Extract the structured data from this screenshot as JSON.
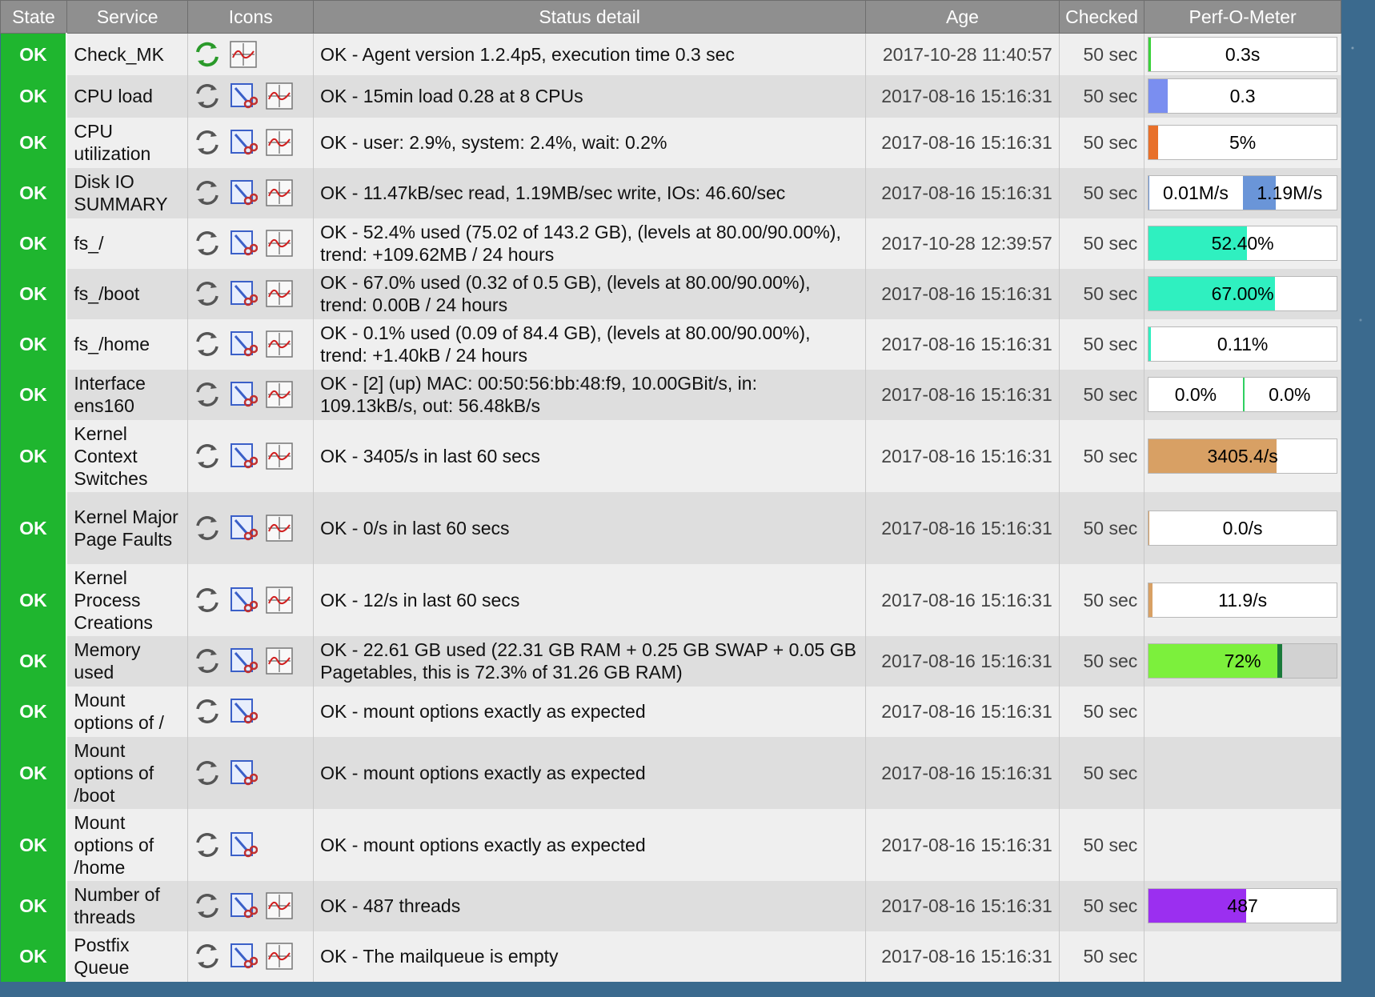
{
  "columns": {
    "state": "State",
    "service": "Service",
    "icons": "Icons",
    "status": "Status detail",
    "age": "Age",
    "checked": "Checked",
    "perf": "Perf-O-Meter"
  },
  "colors": {
    "ok": "#1fb62f",
    "header": "#8f8f8f",
    "load": "#7a8ef0",
    "fs": "#2ff0c0",
    "kernel": "#d8a064",
    "memory": "#7cf03c",
    "threads": "#9b2ff0",
    "disk": "#6a95d8"
  },
  "rows": [
    {
      "state": "OK",
      "service": "Check_MK",
      "icons": [
        "reschedule-icon-green",
        "graph-icon"
      ],
      "status": "OK - Agent version 1.2.4p5, execution time 0.3 sec",
      "age": "2017-10-28 11:40:57",
      "checked": "50 sec",
      "perf": {
        "type": "bar",
        "text": "0.3s",
        "fill": 0.01,
        "color": "#3ad23a"
      }
    },
    {
      "state": "OK",
      "service": "CPU load",
      "icons": [
        "reschedule-icon",
        "edit-rule-icon",
        "graph-icon"
      ],
      "status": "OK - 15min load 0.28 at 8 CPUs",
      "age": "2017-08-16 15:16:31",
      "checked": "50 sec",
      "perf": {
        "type": "bar",
        "text": "0.3",
        "fill": 0.1,
        "color": "#7a8ef0"
      }
    },
    {
      "state": "OK",
      "service": "CPU utilization",
      "icons": [
        "reschedule-icon",
        "edit-rule-icon",
        "graph-icon"
      ],
      "status": "OK - user: 2.9%, system: 2.4%, wait: 0.2%",
      "age": "2017-08-16 15:16:31",
      "checked": "50 sec",
      "perf": {
        "type": "bar",
        "text": "5%",
        "fill": 0.05,
        "color": "#e8702a"
      }
    },
    {
      "state": "OK",
      "service": "Disk IO SUMMARY",
      "icons": [
        "reschedule-icon",
        "edit-rule-icon",
        "graph-icon"
      ],
      "status": "OK - 11.47kB/sec read, 1.19MB/sec write, IOs: 46.60/sec",
      "age": "2017-08-16 15:16:31",
      "checked": "50 sec",
      "perf": {
        "type": "dual",
        "left": "0.01M/s",
        "right": "1.19M/s",
        "left_fill": 0.01,
        "right_fill": 0.35,
        "color": "#6a95d8"
      }
    },
    {
      "state": "OK",
      "service": "fs_/",
      "icons": [
        "reschedule-icon",
        "edit-rule-icon",
        "graph-icon"
      ],
      "status": "OK - 52.4% used (75.02 of 143.2 GB), (levels at 80.00/90.00%), trend: +109.62MB / 24 hours",
      "age": "2017-10-28 12:39:57",
      "checked": "50 sec",
      "perf": {
        "type": "bar",
        "text": "52.40%",
        "fill": 0.524,
        "color": "#2ff0c0"
      }
    },
    {
      "state": "OK",
      "service": "fs_/boot",
      "icons": [
        "reschedule-icon",
        "edit-rule-icon",
        "graph-icon"
      ],
      "status": "OK - 67.0% used (0.32 of 0.5 GB), (levels at 80.00/90.00%), trend: 0.00B / 24 hours",
      "age": "2017-08-16 15:16:31",
      "checked": "50 sec",
      "perf": {
        "type": "bar",
        "text": "67.00%",
        "fill": 0.67,
        "color": "#2ff0c0"
      }
    },
    {
      "state": "OK",
      "service": "fs_/home",
      "icons": [
        "reschedule-icon",
        "edit-rule-icon",
        "graph-icon"
      ],
      "status": "OK - 0.1% used (0.09 of 84.4 GB), (levels at 80.00/90.00%), trend: +1.40kB / 24 hours",
      "age": "2017-08-16 15:16:31",
      "checked": "50 sec",
      "perf": {
        "type": "bar",
        "text": "0.11%",
        "fill": 0.011,
        "color": "#2ff0c0"
      }
    },
    {
      "state": "OK",
      "service": "Interface ens160",
      "icons": [
        "reschedule-icon",
        "edit-rule-icon",
        "graph-icon"
      ],
      "status": "OK - [2] (up) MAC: 00:50:56:bb:48:f9, 10.00GBit/s, in: 109.13kB/s, out: 56.48kB/s",
      "age": "2017-08-16 15:16:31",
      "checked": "50 sec",
      "perf": {
        "type": "dual",
        "left": "0.0%",
        "right": "0.0%",
        "left_fill": 0.0,
        "right_fill": 0.02,
        "color": "#2fd060"
      }
    },
    {
      "state": "OK",
      "service": "Kernel Context Switches",
      "icons": [
        "reschedule-icon",
        "edit-rule-icon",
        "graph-icon"
      ],
      "status": "OK - 3405/s in last 60 secs",
      "age": "2017-08-16 15:16:31",
      "checked": "50 sec",
      "perf": {
        "type": "bar",
        "text": "3405.4/s",
        "fill": 0.68,
        "color": "#d8a064"
      }
    },
    {
      "state": "OK",
      "service": "Kernel Major Page Faults",
      "icons": [
        "reschedule-icon",
        "edit-rule-icon",
        "graph-icon"
      ],
      "status": "OK - 0/s in last 60 secs",
      "age": "2017-08-16 15:16:31",
      "checked": "50 sec",
      "perf": {
        "type": "bar",
        "text": "0.0/s",
        "fill": 0.005,
        "color": "#d8a064"
      }
    },
    {
      "state": "OK",
      "service": "Kernel Process Creations",
      "icons": [
        "reschedule-icon",
        "edit-rule-icon",
        "graph-icon"
      ],
      "status": "OK - 12/s in last 60 secs",
      "age": "2017-08-16 15:16:31",
      "checked": "50 sec",
      "perf": {
        "type": "bar",
        "text": "11.9/s",
        "fill": 0.02,
        "color": "#d8a064"
      }
    },
    {
      "state": "OK",
      "service": "Memory used",
      "icons": [
        "reschedule-icon",
        "edit-rule-icon",
        "graph-icon"
      ],
      "status": "OK - 22.61 GB used (22.31 GB RAM + 0.25 GB SWAP + 0.05 GB Pagetables, this is 72.3% of 31.26 GB RAM)",
      "age": "2017-08-16 15:16:31",
      "checked": "50 sec",
      "perf": {
        "type": "memory",
        "text": "72%",
        "fill": 0.723,
        "color": "#7cf03c"
      }
    },
    {
      "state": "OK",
      "service": "Mount options of /",
      "icons": [
        "reschedule-icon",
        "edit-rule-icon"
      ],
      "status": "OK - mount options exactly as expected",
      "age": "2017-08-16 15:16:31",
      "checked": "50 sec",
      "perf": null
    },
    {
      "state": "OK",
      "service": "Mount options of /boot",
      "icons": [
        "reschedule-icon",
        "edit-rule-icon"
      ],
      "status": "OK - mount options exactly as expected",
      "age": "2017-08-16 15:16:31",
      "checked": "50 sec",
      "perf": null
    },
    {
      "state": "OK",
      "service": "Mount options of /home",
      "icons": [
        "reschedule-icon",
        "edit-rule-icon"
      ],
      "status": "OK - mount options exactly as expected",
      "age": "2017-08-16 15:16:31",
      "checked": "50 sec",
      "perf": null
    },
    {
      "state": "OK",
      "service": "Number of threads",
      "icons": [
        "reschedule-icon",
        "edit-rule-icon",
        "graph-icon"
      ],
      "status": "OK - 487 threads",
      "age": "2017-08-16 15:16:31",
      "checked": "50 sec",
      "perf": {
        "type": "bar",
        "text": "487",
        "fill": 0.52,
        "color": "#9b2ff0"
      }
    },
    {
      "state": "OK",
      "service": "Postfix Queue",
      "icons": [
        "reschedule-icon",
        "edit-rule-icon",
        "graph-icon"
      ],
      "status": "OK - The mailqueue is empty",
      "age": "2017-08-16 15:16:31",
      "checked": "50 sec",
      "perf": null
    }
  ]
}
